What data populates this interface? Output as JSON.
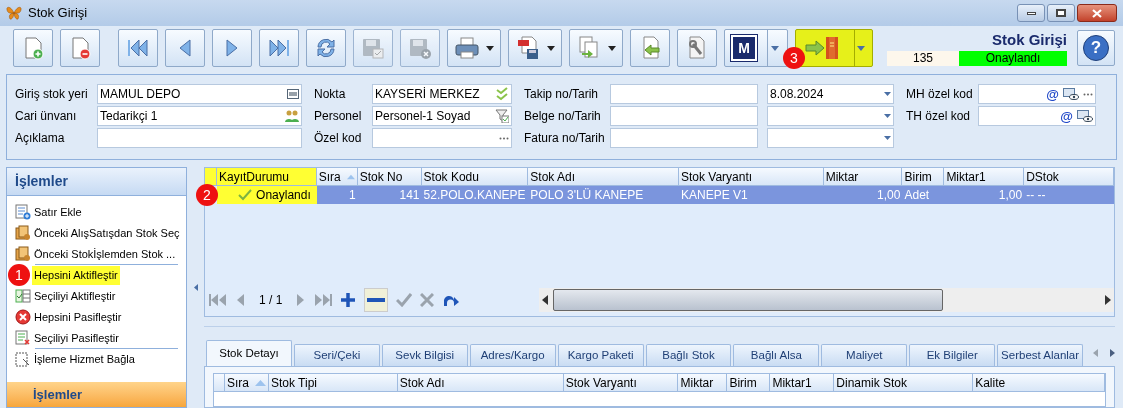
{
  "window": {
    "title": "Stok Girişi"
  },
  "toolbar": {
    "buttons": [
      {
        "kind": "new",
        "disabled": false,
        "dropdown": false,
        "highlighted": false
      },
      {
        "kind": "delete",
        "disabled": false,
        "dropdown": false,
        "highlighted": false
      },
      {
        "kind": "first",
        "disabled": false,
        "dropdown": false,
        "highlighted": false
      },
      {
        "kind": "prev",
        "disabled": false,
        "dropdown": false,
        "highlighted": false
      },
      {
        "kind": "next",
        "disabled": false,
        "dropdown": false,
        "highlighted": false
      },
      {
        "kind": "last",
        "disabled": false,
        "dropdown": false,
        "highlighted": false
      },
      {
        "kind": "refresh",
        "disabled": false,
        "dropdown": false,
        "highlighted": false
      },
      {
        "kind": "save",
        "disabled": true,
        "dropdown": false,
        "highlighted": false
      },
      {
        "kind": "cancel",
        "disabled": true,
        "dropdown": false,
        "highlighted": false
      },
      {
        "kind": "print",
        "disabled": false,
        "dropdown": true,
        "highlighted": false
      },
      {
        "kind": "pdf",
        "disabled": false,
        "dropdown": true,
        "highlighted": false
      },
      {
        "kind": "export",
        "disabled": false,
        "dropdown": true,
        "highlighted": false
      },
      {
        "kind": "import",
        "disabled": false,
        "dropdown": false,
        "highlighted": false
      },
      {
        "kind": "settings",
        "disabled": false,
        "dropdown": false,
        "highlighted": false
      },
      {
        "kind": "m",
        "disabled": false,
        "dropdown": true,
        "highlighted": false,
        "label": "M"
      },
      {
        "kind": "transfer",
        "disabled": false,
        "dropdown": true,
        "highlighted": true,
        "callout": "3"
      }
    ],
    "doc_title": "Stok Girişi",
    "doc_number": "135",
    "status": "Onaylandı",
    "help_label": "?"
  },
  "form": {
    "columns": [
      [
        {
          "label": "Giriş stok yeri",
          "value": "MAMUL DEPO"
        },
        {
          "label": "Cari ünvanı",
          "value": "Tedarikçi 1"
        },
        {
          "label": "Açıklama"
        }
      ],
      [
        {
          "label": "Nokta",
          "value": "KAYSERİ MERKEZ"
        },
        {
          "label": "Personel",
          "value": "Personel-1 Soyad"
        },
        {
          "label": "Özel kod"
        }
      ],
      [
        {
          "label": "Takip no/Tarih",
          "date": "8.08.2024"
        },
        {
          "label": "Belge no/Tarih"
        },
        {
          "label": "Fatura no/Tarih"
        }
      ],
      [
        {
          "label": "MH özel kod",
          "at": "@"
        },
        {
          "label": "TH özel kod",
          "at": "@"
        }
      ]
    ]
  },
  "sidebar": {
    "title": "İşlemler",
    "items": [
      {
        "label": "Satır Ekle",
        "highlighted": false,
        "separator_after": false
      },
      {
        "label": "Önceki AlışSatışdan Stok Seç",
        "highlighted": false,
        "separator_after": false
      },
      {
        "label": "Önceki Stokİşlemden Stok ...",
        "highlighted": false,
        "separator_after": true
      },
      {
        "label": "Hepsini Aktifleştir",
        "highlighted": true,
        "callout": "1",
        "separator_after": false
      },
      {
        "label": "Seçiliyi Aktifleştir",
        "highlighted": false,
        "separator_after": false
      },
      {
        "label": "Hepsini Pasifleştir",
        "highlighted": false,
        "separator_after": false
      },
      {
        "label": "Seçiliyi Pasifleştir",
        "highlighted": false,
        "separator_after": true
      },
      {
        "label": "İşleme Hizmet Bağla",
        "highlighted": false,
        "separator_after": false
      }
    ],
    "footer": "İşlemler"
  },
  "grid": {
    "columns": [
      {
        "label": "KayıtDurumu",
        "highlighted": true,
        "sorted": false
      },
      {
        "label": "Sıra",
        "highlighted": false,
        "sorted": true
      },
      {
        "label": "Stok No",
        "highlighted": false,
        "sorted": false
      },
      {
        "label": "Stok Kodu",
        "highlighted": false,
        "sorted": false
      },
      {
        "label": "Stok Adı",
        "highlighted": false,
        "sorted": false
      },
      {
        "label": "Stok Varyantı",
        "highlighted": false,
        "sorted": false
      },
      {
        "label": "Miktar",
        "highlighted": false,
        "sorted": false
      },
      {
        "label": "Birim",
        "highlighted": false,
        "sorted": false
      },
      {
        "label": "Miktar1",
        "highlighted": false,
        "sorted": false
      },
      {
        "label": "DStok",
        "highlighted": false,
        "sorted": false
      }
    ],
    "rows": [
      {
        "selected": true,
        "callout": "2",
        "cells": [
          "Onaylandı",
          "1",
          "141",
          "52.POLO.KANEPE",
          "POLO 3'LÜ KANEPE",
          "KANEPE V1",
          "1,00",
          "Adet",
          "1,00",
          "-- --"
        ]
      }
    ],
    "navigator": {
      "position": "1 / 1"
    }
  },
  "tabs": [
    {
      "label": "Stok Detayı",
      "selected": true
    },
    {
      "label": "Seri/Çeki",
      "selected": false
    },
    {
      "label": "Sevk Bilgisi",
      "selected": false
    },
    {
      "label": "Adres/Kargo",
      "selected": false
    },
    {
      "label": "Kargo Paketi",
      "selected": false
    },
    {
      "label": "Bağlı Stok",
      "selected": false
    },
    {
      "label": "Bağlı Alsa",
      "selected": false
    },
    {
      "label": "Maliyet",
      "selected": false
    },
    {
      "label": "Ek Bilgiler",
      "selected": false
    },
    {
      "label": "Serbest Alanlar",
      "selected": false
    }
  ],
  "detail_grid": {
    "columns": [
      {
        "label": "Sıra",
        "sorted": true
      },
      {
        "label": "Stok Tipi",
        "sorted": false
      },
      {
        "label": "Stok Adı",
        "sorted": false
      },
      {
        "label": "Stok Varyantı",
        "sorted": false
      },
      {
        "label": "Miktar",
        "sorted": false
      },
      {
        "label": "Birim",
        "sorted": false
      },
      {
        "label": "Miktar1",
        "sorted": false
      },
      {
        "label": "Dinamik Stok",
        "sorted": false
      },
      {
        "label": "Kalite",
        "sorted": false
      }
    ]
  }
}
